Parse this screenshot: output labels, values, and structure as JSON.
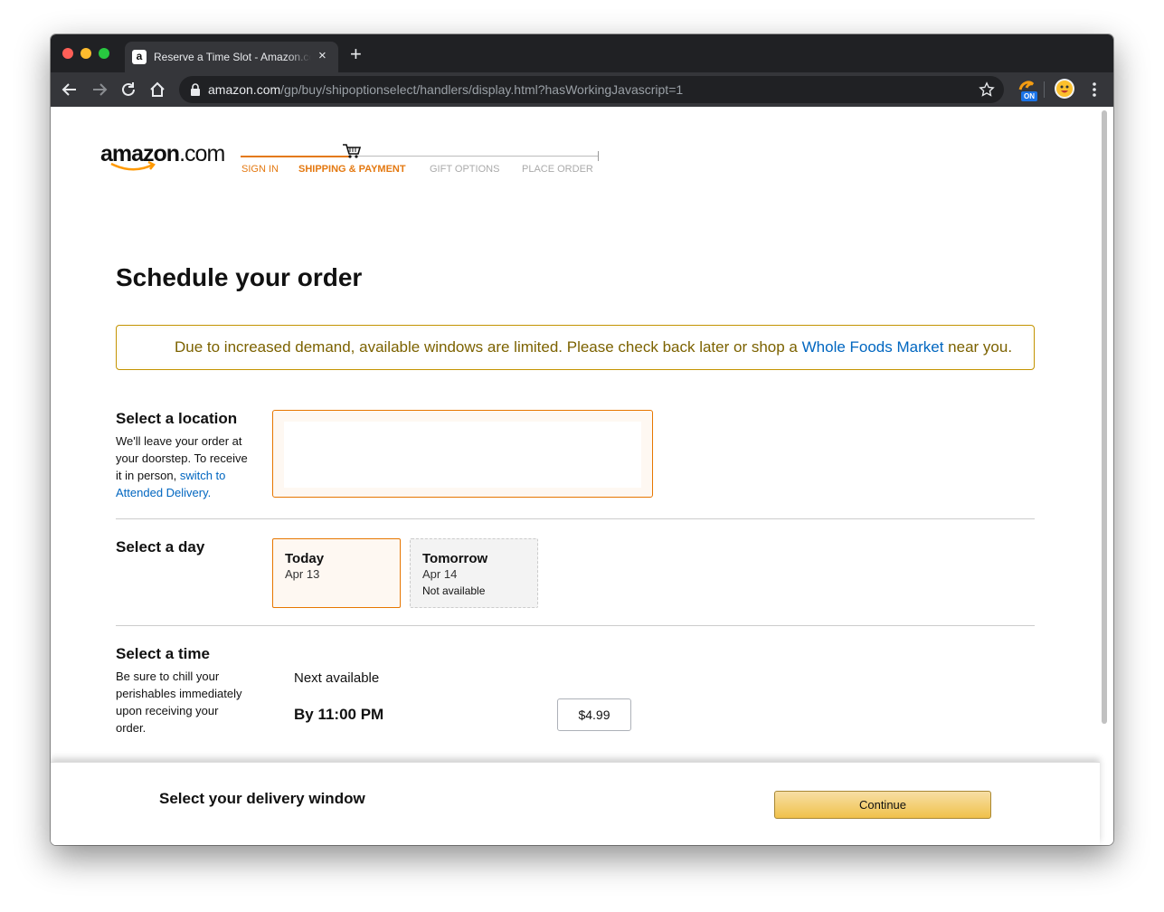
{
  "browser": {
    "tab_title": "Reserve a Time Slot - Amazon.com",
    "tab_favicon": "a",
    "tab_close": "×",
    "new_tab": "+",
    "url_host": "amazon.com",
    "url_path": "/gp/buy/shipoptionselect/handlers/display.html?hasWorkingJavascript=1",
    "extension_badge": "ON"
  },
  "header": {
    "logo_main": "amazon",
    "logo_suffix": ".com",
    "steps": [
      "SIGN IN",
      "SHIPPING & PAYMENT",
      "GIFT OPTIONS",
      "PLACE ORDER"
    ]
  },
  "main": {
    "title": "Schedule your order",
    "alert": {
      "before": "Due to increased demand, available windows are limited. Please check back later or shop a ",
      "link": "Whole Foods Market",
      "after": " near you."
    },
    "location": {
      "title": "Select a location",
      "desc": "We'll leave your order at your doorstep. To receive it in person, ",
      "link": "switch to Attended Delivery."
    },
    "day": {
      "title": "Select a day",
      "options": [
        {
          "name": "Today",
          "date": "Apr 13",
          "status": ""
        },
        {
          "name": "Tomorrow",
          "date": "Apr 14",
          "status": "Not available"
        }
      ]
    },
    "time": {
      "title": "Select a time",
      "desc": "Be sure to chill your perishables immediately upon receiving your order.",
      "next_available": "Next available",
      "slot_label": "By 11:00 PM",
      "slot_price": "$4.99"
    }
  },
  "footer": {
    "title": "Select your delivery window",
    "continue": "Continue"
  },
  "colors": {
    "accent": "#e47911",
    "link": "#0066c0",
    "alert_text": "#7c6200",
    "alert_border": "#c39301",
    "button": "#f0c14b"
  }
}
